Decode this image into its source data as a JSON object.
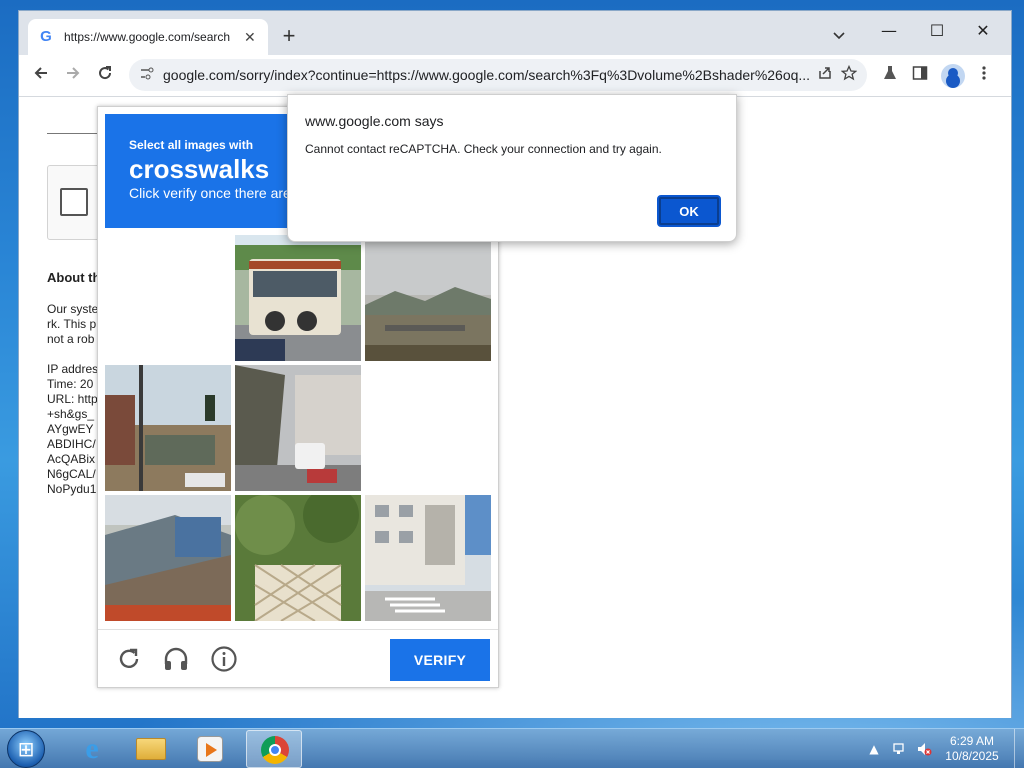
{
  "browser": {
    "tab_title": "https://www.google.com/search",
    "tab_close": "✕",
    "new_tab": "+",
    "tab_search": "⌄",
    "win_min": "—",
    "win_max": "☐",
    "win_close": "✕",
    "url": "google.com/sorry/index?continue=https://www.google.com/search%3Fq%3Dvolume%2Bshader%26oq...",
    "icons": [
      "back-icon",
      "forward-icon",
      "reload-icon",
      "site-info-icon",
      "share-icon",
      "star-icon",
      "labs-icon",
      "side-panel-icon",
      "profile-icon",
      "menu-icon"
    ]
  },
  "page": {
    "about_heading": "About th",
    "para1": [
      "Our syste",
      "rk. This p",
      "not a rob"
    ],
    "para2": [
      "IP addres",
      "Time: 20",
      "URL: http",
      "+sh&gs_",
      "AYgwEY",
      "ABDIHC/",
      "AcQABix",
      "N6gCAL/",
      "NoPydu1"
    ]
  },
  "captcha": {
    "instruction_small": "Select all images with",
    "target": "crosswalks",
    "instruction_sub": "Click verify once there are",
    "verify_label": "VERIFY",
    "tiles": [
      "blank",
      "bus",
      "bridge-landscape",
      "street-traffic-light",
      "street-bus",
      "blank",
      "hillside-fence",
      "garden-fence",
      "building-crosswalk"
    ],
    "footer_icons": [
      "reload-icon",
      "audio-icon",
      "info-icon"
    ]
  },
  "dialog": {
    "title": "www.google.com says",
    "message": "Cannot contact reCAPTCHA. Check your connection and try again.",
    "ok_label": "OK"
  },
  "taskbar": {
    "apps": [
      "internet-explorer-icon",
      "file-explorer-icon",
      "media-player-icon",
      "chrome-icon"
    ],
    "time": "6:29 AM",
    "date": "10/8/2025"
  },
  "colors": {
    "captcha_blue": "#1a73e8",
    "dialog_button": "#0b57d0"
  }
}
